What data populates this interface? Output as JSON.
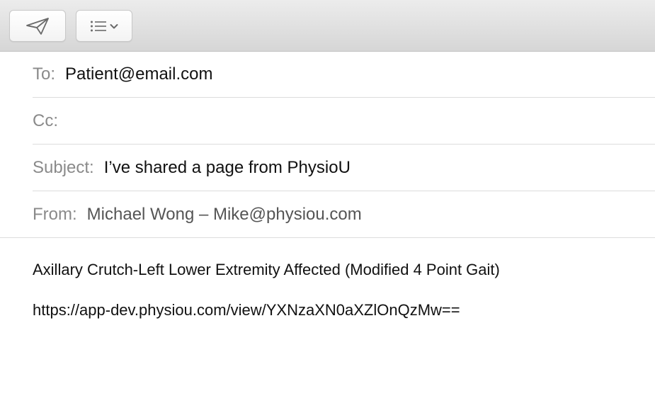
{
  "toolbar": {
    "send_icon": "paper-plane-icon",
    "format_icon": "list-icon",
    "format_dropdown_icon": "chevron-down-icon"
  },
  "header": {
    "to": {
      "label": "To:",
      "value": "Patient@email.com"
    },
    "cc": {
      "label": "Cc:",
      "value": ""
    },
    "subject": {
      "label": "Subject:",
      "value": "I’ve shared a page from PhysioU"
    },
    "from": {
      "label": "From:",
      "value": "Michael Wong – Mike@physiou.com"
    }
  },
  "body": {
    "line1": "Axillary Crutch-Left Lower Extremity Affected (Modified 4 Point Gait)",
    "line2": "https://app-dev.physiou.com/view/YXNzaXN0aXZlOnQzMw=="
  },
  "colors": {
    "label_gray": "#8a8a8a",
    "divider": "#dcdcdc",
    "toolbar_bg": "#e0e0e0"
  }
}
